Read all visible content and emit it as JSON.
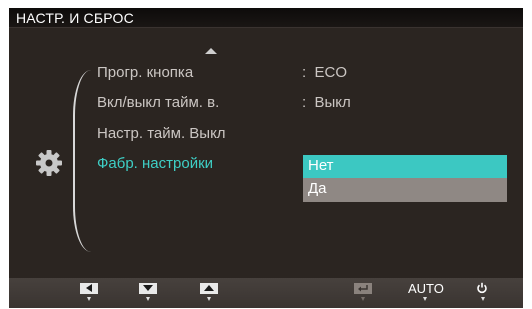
{
  "window": {
    "title": "НАСТР. И СБРОС"
  },
  "menu": {
    "items": [
      {
        "label": "Прогр. кнопка",
        "value": "ECO"
      },
      {
        "label": "Вкл/выкл тайм. в.",
        "value": "Выкл"
      },
      {
        "label": "Настр. тайм. Выкл",
        "value": ""
      },
      {
        "label": "Фабр. настройки",
        "value": ""
      }
    ],
    "value_separator": ":",
    "selected_index": 3
  },
  "dropdown": {
    "options": [
      "Нет",
      "Да"
    ],
    "selected_index": 0
  },
  "bottom_bar": {
    "auto_label": "AUTO",
    "keys": [
      "left-arrow-icon",
      "down-arrow-icon",
      "up-arrow-icon",
      "enter-icon",
      "auto",
      "power-icon"
    ]
  },
  "colors": {
    "background": "#2b2521",
    "accent": "#3ecfc6",
    "dropdown_selected": "#3cc8c2",
    "dropdown_option": "#8f8884",
    "bottom_bar": "#413b37"
  }
}
